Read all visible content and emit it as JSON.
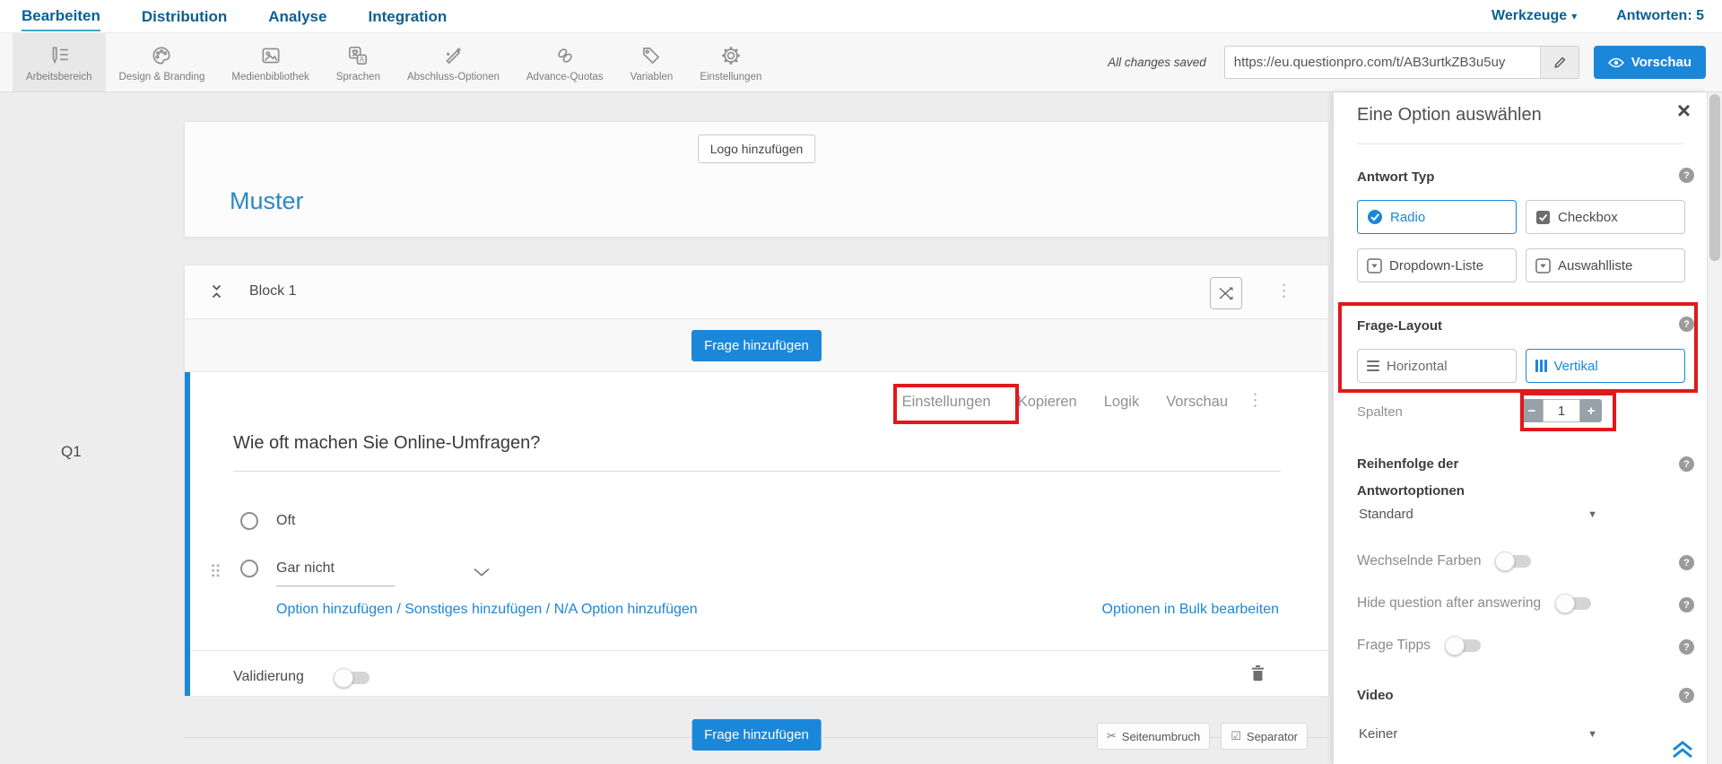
{
  "nav": {
    "items": [
      {
        "label": "Bearbeiten",
        "active": true
      },
      {
        "label": "Distribution",
        "active": false
      },
      {
        "label": "Analyse",
        "active": false
      },
      {
        "label": "Integration",
        "active": false
      }
    ],
    "tools_label": "Werkzeuge",
    "responses_label": "Antworten: 5"
  },
  "toolbar": {
    "items": [
      {
        "label": "Arbeitsbereich",
        "active": true
      },
      {
        "label": "Design & Branding",
        "active": false
      },
      {
        "label": "Medienbibliothek",
        "active": false
      },
      {
        "label": "Sprachen",
        "active": false
      },
      {
        "label": "Abschluss-Optionen",
        "active": false
      },
      {
        "label": "Advance-Quotas",
        "active": false
      },
      {
        "label": "Variablen",
        "active": false
      },
      {
        "label": "Einstellungen",
        "active": false
      }
    ],
    "saved_text": "All changes saved",
    "url": "https://eu.questionpro.com/t/AB3urtkZB3u5uy",
    "preview_label": "Vorschau"
  },
  "survey": {
    "logo_button_label": "Logo hinzufügen",
    "title": "Muster"
  },
  "block": {
    "title": "Block 1",
    "add_question_label": "Frage hinzufügen"
  },
  "question": {
    "id_label": "Q1",
    "tabs": [
      {
        "label": "Einstellungen"
      },
      {
        "label": "Kopieren"
      },
      {
        "label": "Logik"
      },
      {
        "label": "Vorschau"
      }
    ],
    "text": "Wie oft machen Sie Online-Umfragen?",
    "options": [
      {
        "label": "Oft"
      },
      {
        "label": "Gar nicht"
      }
    ],
    "links": [
      {
        "label": "Option hinzufügen"
      },
      {
        "label": "Sonstiges hinzufügen"
      },
      {
        "label": "N/A Option hinzufügen"
      }
    ],
    "links_separator": "/",
    "bulk_edit_label": "Optionen in Bulk bearbeiten",
    "validation_label": "Validierung"
  },
  "footer": {
    "add_question_label": "Frage hinzufügen",
    "page_break_label": "Seitenumbruch",
    "separator_label": "Separator"
  },
  "panel": {
    "title": "Eine Option auswählen",
    "answer_type": {
      "label": "Antwort Typ",
      "options": [
        {
          "label": "Radio",
          "selected": true
        },
        {
          "label": "Checkbox",
          "selected": false
        },
        {
          "label": "Dropdown-Liste",
          "selected": false
        },
        {
          "label": "Auswahlliste",
          "selected": false
        }
      ]
    },
    "layout": {
      "label": "Frage-Layout",
      "options": [
        {
          "label": "Horizontal",
          "selected": false
        },
        {
          "label": "Vertikal",
          "selected": true
        }
      ]
    },
    "columns": {
      "label": "Spalten",
      "value": "1",
      "decrement": "−",
      "increment": "+"
    },
    "order": {
      "label_line1": "Reihenfolge der",
      "label_line2": "Antwortoptionen",
      "value": "Standard"
    },
    "toggles": [
      {
        "label": "Wechselnde Farben",
        "on": false
      },
      {
        "label": "Hide question after answering",
        "on": false
      },
      {
        "label": "Frage Tipps",
        "on": false
      }
    ],
    "video": {
      "label": "Video",
      "value": "Keiner"
    }
  },
  "icons": {
    "caret_down": "▾",
    "menu_dots": "⋮",
    "close": "×",
    "help": "?",
    "scissors": "✂",
    "checkbox_glyph": "☑"
  },
  "colors": {
    "accent_blue": "#1b87d9",
    "nav_blue": "#0d5f92",
    "annotation_red": "#e0191c"
  }
}
